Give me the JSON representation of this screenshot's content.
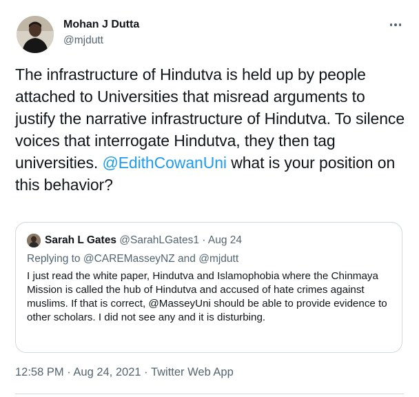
{
  "author": {
    "name": "Mohan J Dutta",
    "handle": "@mjdutt"
  },
  "tweet": {
    "text_1": "The infrastructure of Hindutva is held up by people attached to Universities that misread arguments to justify the narrative infrastructure of Hindutva. To silence voices that interrogate Hindutva, they then tag universities. ",
    "mention": "@EdithCowanUni",
    "text_2": " what is your position on this behavior?"
  },
  "quoted_tweet": {
    "name": "Sarah L Gates",
    "handle": "@SarahLGates1",
    "separator": " · ",
    "date": "Aug 24",
    "replying_prefix": "Replying to ",
    "replying_mention_1": "@CAREMasseyNZ",
    "replying_and": " and ",
    "replying_mention_2": "@mjdutt",
    "text": "I just read the white paper, Hindutva and Islamophobia where the Chinmaya Mission is called the hub of Hindutva and accused of hate crimes against muslims. If that is correct, @MasseyUni should be able to provide evidence to other scholars. I did not see any and it is disturbing."
  },
  "meta": {
    "time": "12:58 PM",
    "sep1": " · ",
    "date": "Aug 24, 2021",
    "sep2": " · ",
    "app": "Twitter Web App"
  },
  "colors": {
    "text": "#0f1419",
    "secondary": "#536471",
    "link": "#1d9bf0",
    "border": "#cfd9de"
  },
  "icons": {
    "more": "more-dots-icon"
  }
}
